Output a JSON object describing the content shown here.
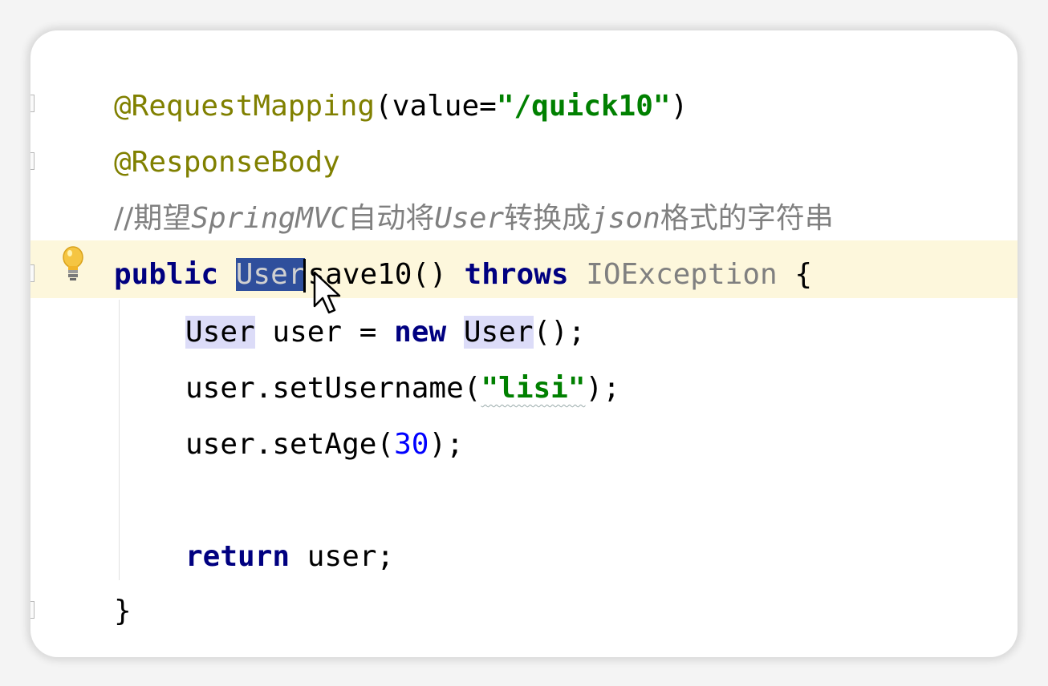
{
  "editor": {
    "lines": {
      "annotation1_name": "@RequestMapping",
      "annotation1_open": "(value=",
      "annotation1_value": "\"/quick10\"",
      "annotation1_close": ")",
      "annotation2": "@ResponseBody",
      "comment_prefix": "//期望",
      "comment_springmvc": "SpringMVC",
      "comment_mid1": "自动将",
      "comment_user": "User",
      "comment_mid2": "转换成",
      "comment_json": "json",
      "comment_suffix": "格式的字符串",
      "method_public": "public",
      "method_return_type": "User",
      "method_name": "save10()",
      "method_throws": "throws",
      "method_exception": "IOException",
      "method_brace": "{",
      "decl_type": "User",
      "decl_var": "user =",
      "decl_new": "new",
      "decl_ctor": "User",
      "decl_end": "();",
      "set_username_call": "user.setUsername(",
      "set_username_arg": "\"lisi\"",
      "set_username_end": ");",
      "set_age_call": "user.setAge(",
      "set_age_arg": "30",
      "set_age_end": ");",
      "return_kw": "return",
      "return_val": "user;",
      "close_brace": "}"
    },
    "icons": {
      "intention": "lightbulb-icon",
      "mouse": "mouse-cursor-icon"
    },
    "colors": {
      "annotation": "#808000",
      "keyword": "#000080",
      "string": "#008000",
      "number": "#0000ff",
      "comment": "#808080",
      "selection": "#2f4f9c",
      "current_line": "#fdf7dc"
    }
  }
}
